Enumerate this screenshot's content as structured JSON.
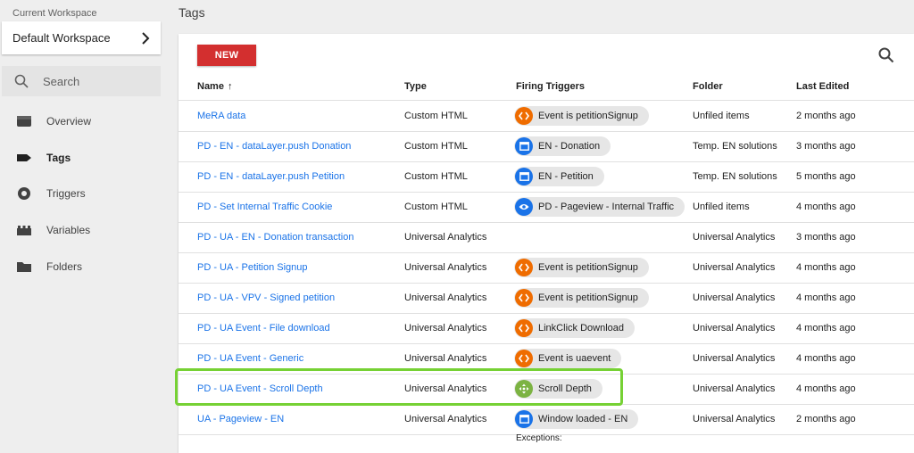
{
  "sidebar": {
    "workspace_label": "Current Workspace",
    "workspace_name": "Default Workspace",
    "search_placeholder": "Search",
    "items": [
      {
        "label": "Overview",
        "icon": "overview-icon"
      },
      {
        "label": "Tags",
        "icon": "tag-icon"
      },
      {
        "label": "Triggers",
        "icon": "trigger-icon"
      },
      {
        "label": "Variables",
        "icon": "variables-icon"
      },
      {
        "label": "Folders",
        "icon": "folder-icon"
      }
    ],
    "active_item": "Tags"
  },
  "main": {
    "title": "Tags",
    "new_button": "NEW",
    "columns": {
      "name": "Name",
      "sort_arrow": "↑",
      "type": "Type",
      "triggers": "Firing Triggers",
      "folder": "Folder",
      "edited": "Last Edited"
    },
    "rows": [
      {
        "name": "MeRA data",
        "type": "Custom HTML",
        "trigger": "Event is petitionSignup",
        "trigger_icon": "custom-event-icon",
        "folder": "Unfiled items",
        "edited": "2 months ago"
      },
      {
        "name": "PD - EN - dataLayer.push Donation",
        "type": "Custom HTML",
        "trigger": "EN - Donation",
        "trigger_icon": "window-loaded-icon",
        "folder": "Temp. EN solutions",
        "edited": "3 months ago"
      },
      {
        "name": "PD - EN - dataLayer.push Petition",
        "type": "Custom HTML",
        "trigger": "EN - Petition",
        "trigger_icon": "window-loaded-icon",
        "folder": "Temp. EN solutions",
        "edited": "5 months ago"
      },
      {
        "name": "PD - Set Internal Traffic Cookie",
        "type": "Custom HTML",
        "trigger": "PD - Pageview - Internal Traffic",
        "trigger_icon": "pageview-icon",
        "folder": "Unfiled items",
        "edited": "4 months ago"
      },
      {
        "name": "PD - UA - EN - Donation transaction",
        "type": "Universal Analytics",
        "trigger": "",
        "trigger_icon": "",
        "folder": "Universal Analytics",
        "edited": "3 months ago"
      },
      {
        "name": "PD - UA - Petition Signup",
        "type": "Universal Analytics",
        "trigger": "Event is petitionSignup",
        "trigger_icon": "custom-event-icon",
        "folder": "Universal Analytics",
        "edited": "4 months ago"
      },
      {
        "name": "PD - UA - VPV - Signed petition",
        "type": "Universal Analytics",
        "trigger": "Event is petitionSignup",
        "trigger_icon": "custom-event-icon",
        "folder": "Universal Analytics",
        "edited": "4 months ago"
      },
      {
        "name": "PD - UA Event - File download",
        "type": "Universal Analytics",
        "trigger": "LinkClick Download",
        "trigger_icon": "custom-event-icon",
        "folder": "Universal Analytics",
        "edited": "4 months ago"
      },
      {
        "name": "PD - UA Event - Generic",
        "type": "Universal Analytics",
        "trigger": "Event is uaevent",
        "trigger_icon": "custom-event-icon",
        "folder": "Universal Analytics",
        "edited": "4 months ago"
      },
      {
        "name": "PD - UA Event - Scroll Depth",
        "type": "Universal Analytics",
        "trigger": "Scroll Depth",
        "trigger_icon": "scroll-depth-icon",
        "folder": "Universal Analytics",
        "edited": "4 months ago"
      },
      {
        "name": "UA - Pageview - EN",
        "type": "Universal Analytics",
        "trigger": "Window loaded - EN",
        "trigger_icon": "window-loaded-icon",
        "folder": "Universal Analytics",
        "edited": "2 months ago"
      }
    ],
    "exceptions_label": "Exceptions:",
    "highlighted_row": "PD - UA Event - Scroll Depth"
  },
  "colors": {
    "accent_red": "#d32f2f",
    "link_blue": "#1a73e8",
    "custom_event_orange": "#ef6c00",
    "scroll_green": "#7cb342",
    "highlight_green": "#76d134"
  }
}
